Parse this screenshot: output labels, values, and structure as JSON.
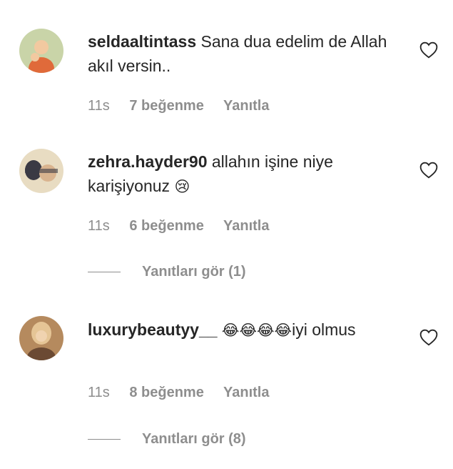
{
  "comments": [
    {
      "username": "seldaaltintass",
      "text": "Sana dua edelim de Allah akıl versin..",
      "emoji": "",
      "text_after": "",
      "time": "11s",
      "likes": "7 beğenme",
      "reply": "Yanıtla",
      "view_replies": "",
      "avatar_colors": [
        "#c9d4a8",
        "#e06a3a",
        "#f2c9a0"
      ]
    },
    {
      "username": "zehra.hayder90",
      "text": "allahın işine niye karişiyonuz",
      "emoji": "😢",
      "text_after": "",
      "time": "11s",
      "likes": "6 beğenme",
      "reply": "Yanıtla",
      "view_replies": "Yanıtları gör (1)",
      "avatar_colors": [
        "#e8dcc2",
        "#3b3a44",
        "#d9b48f"
      ]
    },
    {
      "username": "luxurybeautyy__",
      "text": "",
      "emoji": "😂😂😂😂",
      "text_after": "iyi olmus",
      "time": "11s",
      "likes": "8 beğenme",
      "reply": "Yanıtla",
      "view_replies": "Yanıtları gör (8)",
      "avatar_colors": [
        "#b58a5e",
        "#e5c596",
        "#6b4a33"
      ]
    }
  ],
  "colors": {
    "text": "#262626",
    "muted": "#8e8e8e"
  },
  "icons": {
    "like": "heart-outline-icon"
  }
}
